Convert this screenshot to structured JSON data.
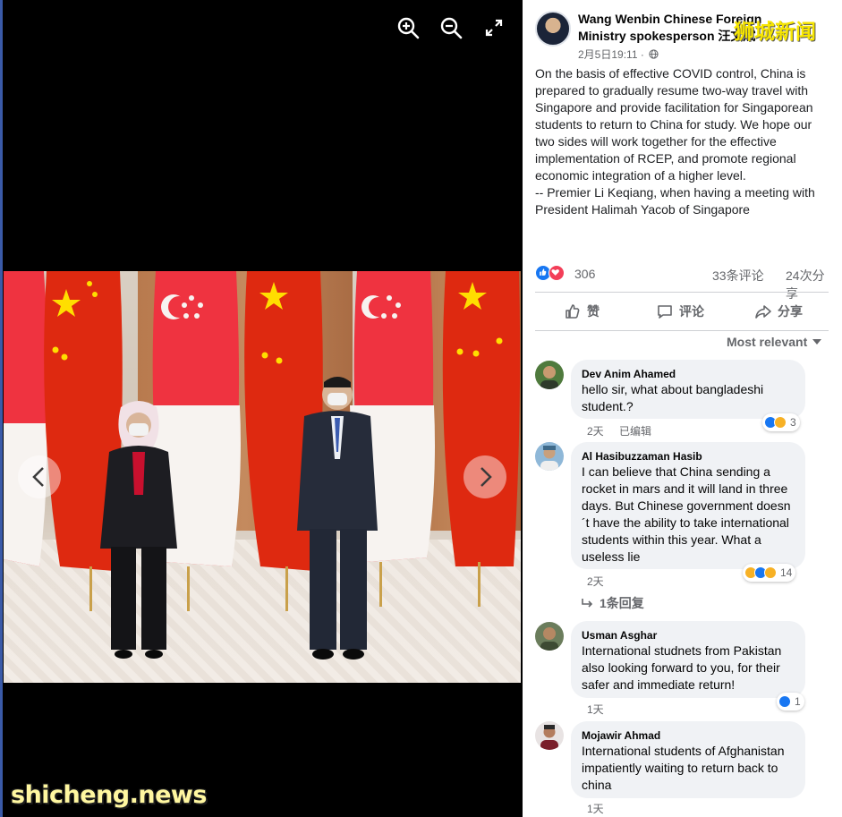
{
  "colors": {
    "viewer_bg": "#000000",
    "like_blue": "#1877f2",
    "love_red": "#f33e58",
    "bubble_bg": "#f0f2f5",
    "muted_text": "#65676b",
    "flag_red_china": "#de2910",
    "flag_red_singapore": "#ef3340"
  },
  "viewer": {
    "tools": [
      "zoom-in-icon",
      "zoom-out-icon",
      "fullscreen-icon"
    ],
    "prev_icon": "chevron-left-icon",
    "next_icon": "chevron-right-icon",
    "watermark": "shicheng.news"
  },
  "post": {
    "author": "Wang Wenbin Chinese Foreign Ministry spokesperson 汪文斌",
    "watermark": "狮城新闻",
    "time": "2月5日19:11 ·",
    "privacy_icon": "globe-icon",
    "text": "On the basis of effective COVID control, China is prepared to gradually resume two-way travel with Singapore and provide facilitation for Singaporean students to return to China for study. We hope our two sides will work together for the effective implementation of RCEP, and promote regional economic integration of a higher level.\n-- Premier Li Keqiang, when having a meeting with President Halimah Yacob of Singapore",
    "reaction_count": "306",
    "comment_count": "33条评论",
    "share_count": "24次分享",
    "actions": {
      "like": "赞",
      "comment": "评论",
      "share": "分享"
    },
    "sort_label": "Most relevant"
  },
  "comments": [
    {
      "name": "Dev Anim Ahamed",
      "text": "hello sir, what about bangladeshi student.?",
      "time": "2天",
      "edited": "已编辑",
      "reaction_count": "3"
    },
    {
      "name": "Al Hasibuzzaman Hasib",
      "text": "I can believe that China sending a rocket in mars and it will land in three days. But Chinese government doesn´t have the ability to take international students within this year. What a useless lie",
      "time": "2天",
      "reaction_count": "14",
      "replies": "1条回复"
    },
    {
      "name": "Usman Asghar",
      "text": "International studnets from Pakistan also looking forward to you, for their safer and immediate return!",
      "time": "1天",
      "reaction_count": "1"
    },
    {
      "name": "Mojawir Ahmad",
      "text": "International students of Afghanistan impatiently waiting to return back to china",
      "time": "1天"
    }
  ]
}
